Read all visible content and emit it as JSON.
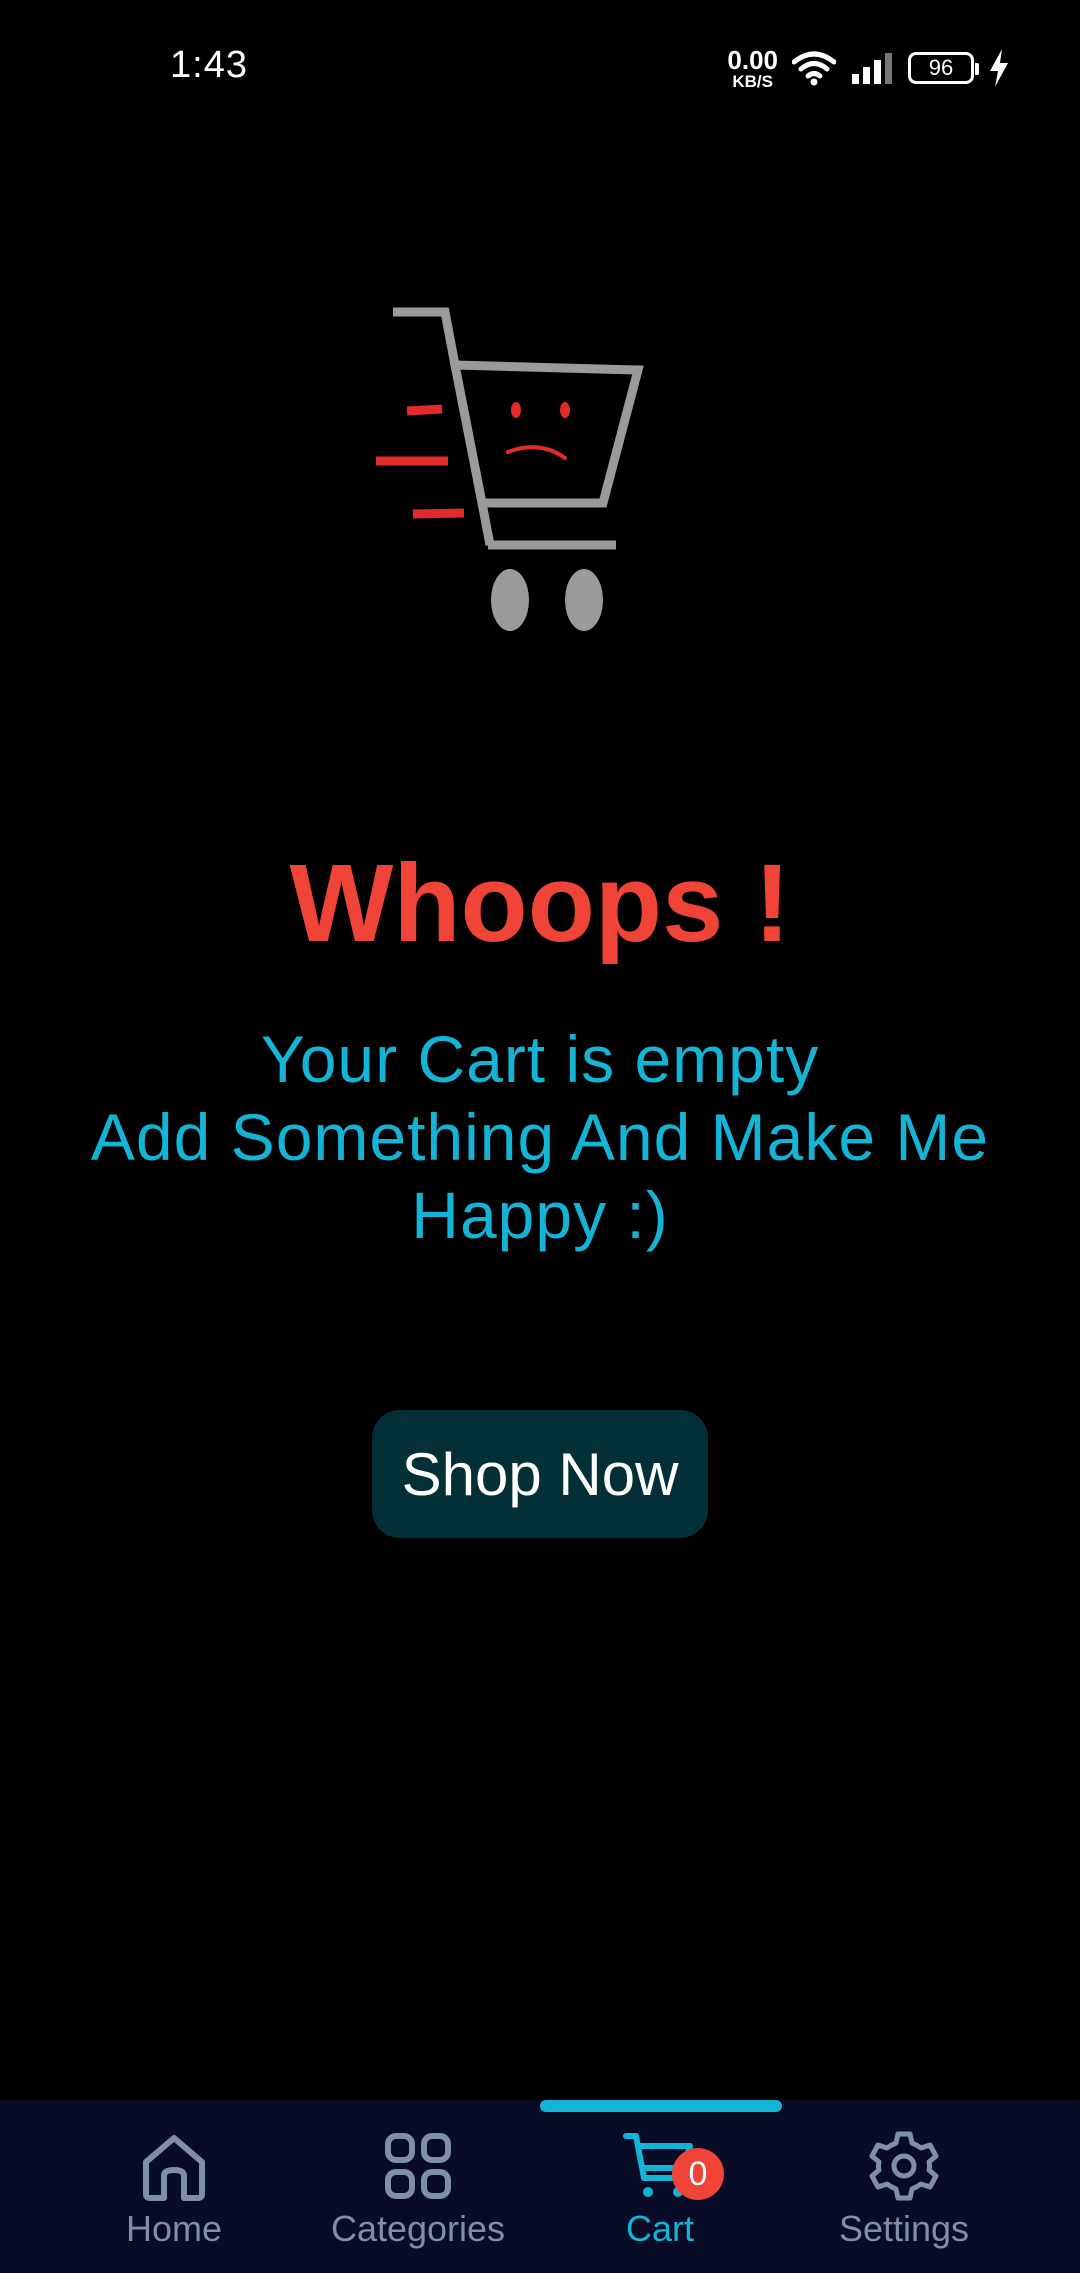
{
  "status_bar": {
    "time": "1:43",
    "net_speed_value": "0.00",
    "net_speed_unit": "KB/S",
    "battery": "96",
    "icons": [
      "wifi-icon",
      "signal-icon",
      "battery-icon",
      "charging-icon"
    ]
  },
  "empty_cart": {
    "illustration": "sad-cart-icon",
    "headline": "Whoops !",
    "message_line1": "Your Cart is empty",
    "message_line2": "Add Something And Make Me",
    "message_line3": "Happy :)",
    "button_label": "Shop Now"
  },
  "bottom_nav": {
    "items": [
      {
        "label": "Home",
        "icon": "home-icon"
      },
      {
        "label": "Categories",
        "icon": "categories-icon"
      },
      {
        "label": "Cart",
        "icon": "cart-icon",
        "badge": "0",
        "active": true
      },
      {
        "label": "Settings",
        "icon": "gear-icon"
      }
    ]
  },
  "colors": {
    "background": "#000000",
    "headline": "#f04438",
    "message": "#13b4d6",
    "button_bg": "#033036",
    "nav_bg": "#080c26",
    "nav_active": "#13b4d6",
    "nav_inactive": "#7f8fa4",
    "badge": "#f04438"
  }
}
